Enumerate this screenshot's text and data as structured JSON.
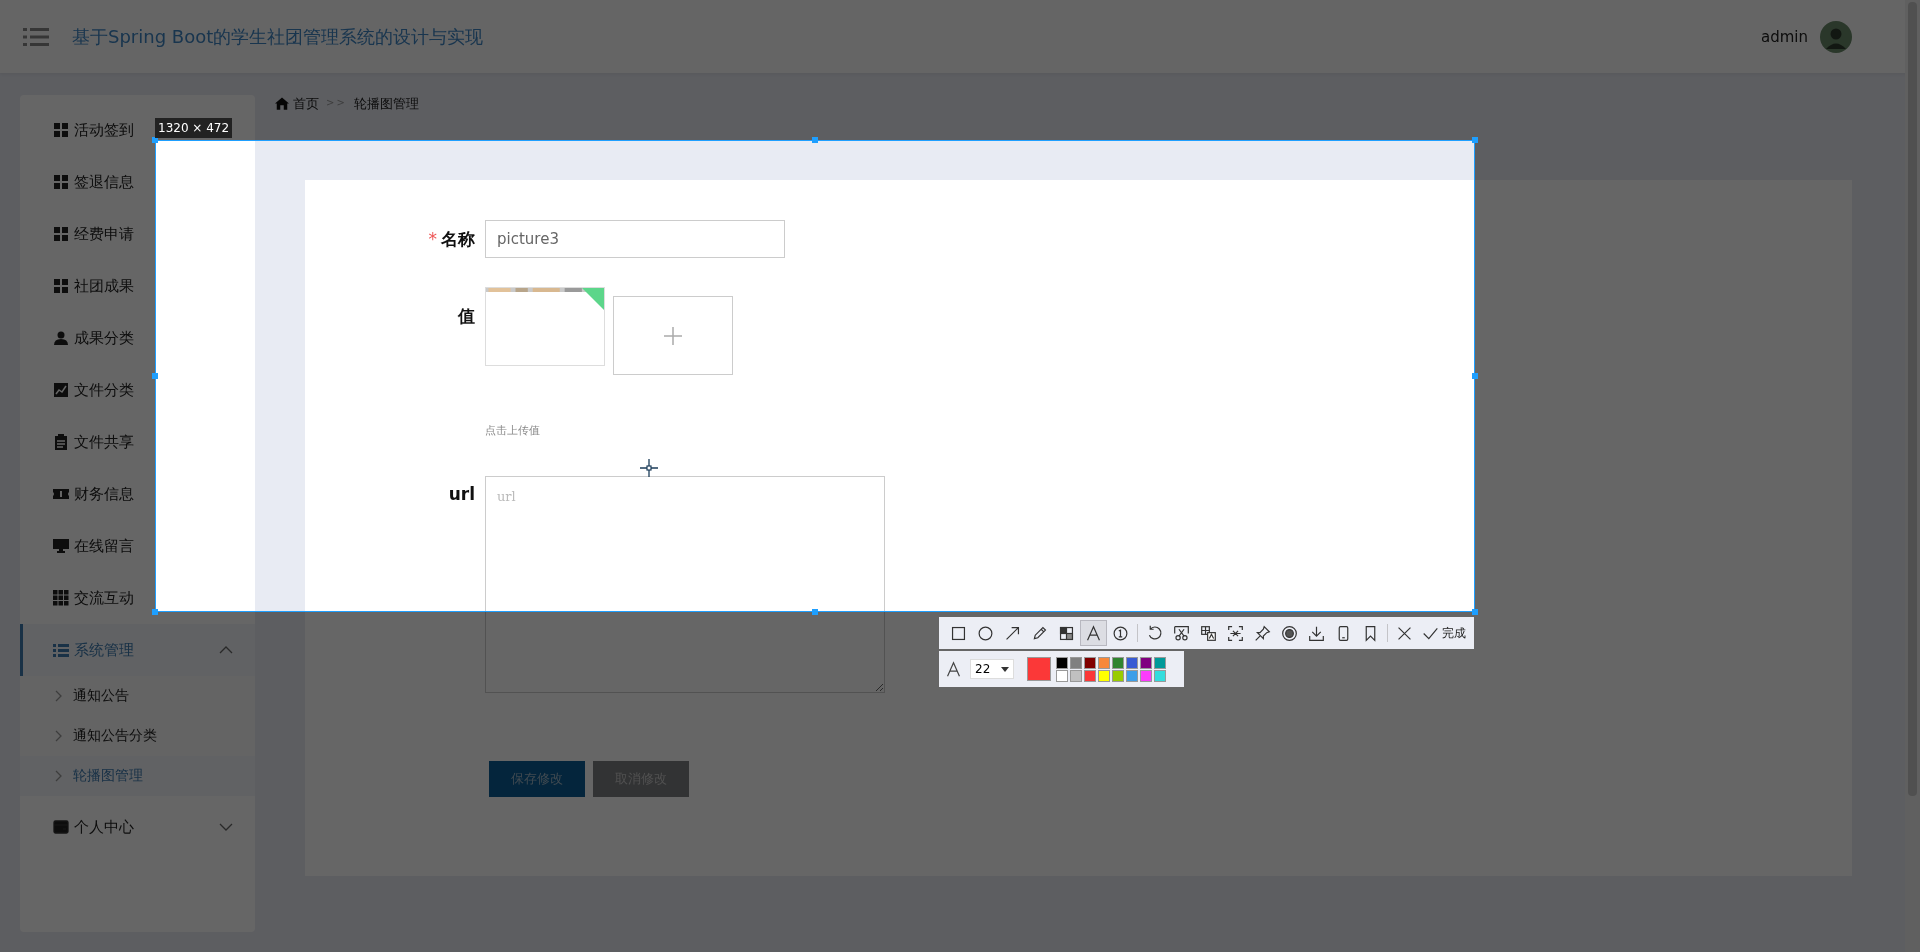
{
  "header": {
    "title": "基于Spring Boot的学生社团管理系统的设计与实现",
    "user": "admin"
  },
  "sidebar": {
    "items": [
      {
        "label": "活动签到",
        "selected": false
      },
      {
        "label": "签退信息",
        "selected": false
      },
      {
        "label": "经费申请",
        "selected": false
      },
      {
        "label": "社团成果",
        "selected": false
      },
      {
        "label": "成果分类",
        "selected": false
      },
      {
        "label": "文件分类",
        "selected": false
      },
      {
        "label": "文件共享",
        "selected": false
      },
      {
        "label": "财务信息",
        "selected": false
      },
      {
        "label": "在线留言",
        "selected": false
      },
      {
        "label": "交流互动",
        "selected": false
      },
      {
        "label": "系统管理",
        "selected": true,
        "expanded": true,
        "children": [
          {
            "label": "通知公告",
            "selected": false
          },
          {
            "label": "通知公告分类",
            "selected": false
          },
          {
            "label": "轮播图管理",
            "selected": true
          }
        ]
      },
      {
        "label": "个人中心",
        "selected": false,
        "expanded": false
      }
    ]
  },
  "breadcrumb": {
    "items": [
      "首页",
      "轮播图管理"
    ],
    "separator": ">>"
  },
  "form": {
    "fields": [
      {
        "kind": "text",
        "label": "名称",
        "required": true,
        "value": "picture3"
      },
      {
        "kind": "upload",
        "label": "值",
        "required": false,
        "uploaded": true,
        "hint": "点击上传值"
      },
      {
        "kind": "textarea",
        "label": "url",
        "required": false,
        "placeholder": "url"
      }
    ],
    "required_mark": "*",
    "buttons": [
      {
        "kind": "primary",
        "label": "保存修改"
      },
      {
        "kind": "default",
        "label": "取消修改"
      }
    ]
  },
  "screenshot_tool": {
    "size_label": "1320 × 472",
    "tools": [
      {
        "selected": false
      },
      {
        "selected": false
      },
      {
        "selected": false
      },
      {
        "selected": false
      },
      {
        "selected": false
      },
      {
        "selected": true
      },
      {
        "selected": false
      },
      {
        "selected": false
      },
      {
        "selected": false
      },
      {
        "selected": false
      },
      {
        "selected": false
      },
      {
        "selected": false
      },
      {
        "selected": false
      },
      {
        "selected": false
      },
      {
        "selected": false
      },
      {
        "selected": false
      }
    ],
    "done_label": "完成",
    "font_size": "22",
    "current_color": {
      "color": "#fb3838"
    },
    "palette": [
      {
        "color": "#000000"
      },
      {
        "color": "#808080"
      },
      {
        "color": "#800000"
      },
      {
        "color": "#f7883a"
      },
      {
        "color": "#308430"
      },
      {
        "color": "#385ad3"
      },
      {
        "color": "#800080"
      },
      {
        "color": "#009999"
      },
      {
        "color": "#ffffff"
      },
      {
        "color": "#c0c0c0"
      },
      {
        "color": "#fb3838"
      },
      {
        "color": "#ffff00"
      },
      {
        "color": "#99cc00"
      },
      {
        "color": "#3d9ee8"
      },
      {
        "color": "#fb3bfb"
      },
      {
        "color": "#33dddd"
      }
    ]
  }
}
